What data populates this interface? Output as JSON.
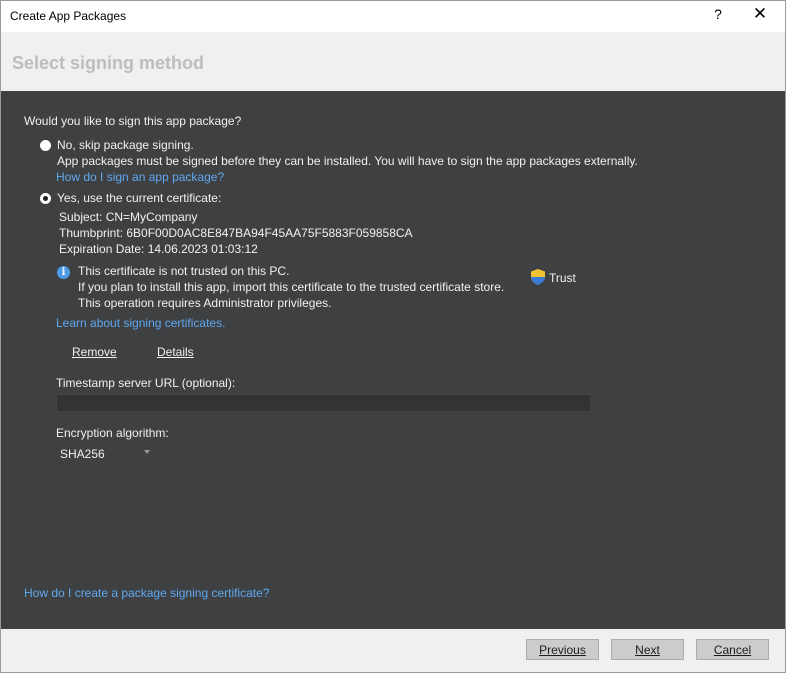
{
  "window": {
    "title": "Create App Packages",
    "help_label": "?",
    "close_label": "✕"
  },
  "header": {
    "title": "Select signing method"
  },
  "main": {
    "question": "Would you like to sign this app package?",
    "option_skip": {
      "label": "No, skip package signing.",
      "description": "App packages must be signed before they can be installed. You will have to sign the app packages externally.",
      "link": "How do I sign an app package?",
      "selected": false
    },
    "option_current": {
      "label": "Yes, use the current certificate:",
      "selected": true,
      "subject": "Subject: CN=MyCompany",
      "thumbprint": "Thumbprint: 6B0F00D0AC8E847BA94F45AA75F5883F059858CA",
      "expiration": "Expiration Date: 14.06.2023 01:03:12"
    },
    "warning": {
      "line1": "This certificate is not trusted on this PC.",
      "line2": "If you plan to install this app, import this certificate to the trusted certificate store.",
      "line3": "This operation requires Administrator privileges.",
      "trust_label": "Trust"
    },
    "learn_link": "Learn about signing certificates.",
    "remove_label": "Remove",
    "details_label": "Details",
    "timestamp": {
      "label": "Timestamp server URL (optional):",
      "value": "",
      "placeholder": ""
    },
    "encryption": {
      "label": "Encryption algorithm:",
      "selected": "SHA256"
    },
    "bottom_link": "How do I create a package signing certificate?"
  },
  "footer": {
    "previous_label": "Previous",
    "next_label": "Next",
    "cancel_label": "Cancel"
  },
  "colors": {
    "content_bg": "#3f4042",
    "link": "#5fa8f0",
    "header_bg": "#f0f0f0",
    "info": "#4d9ae6"
  }
}
